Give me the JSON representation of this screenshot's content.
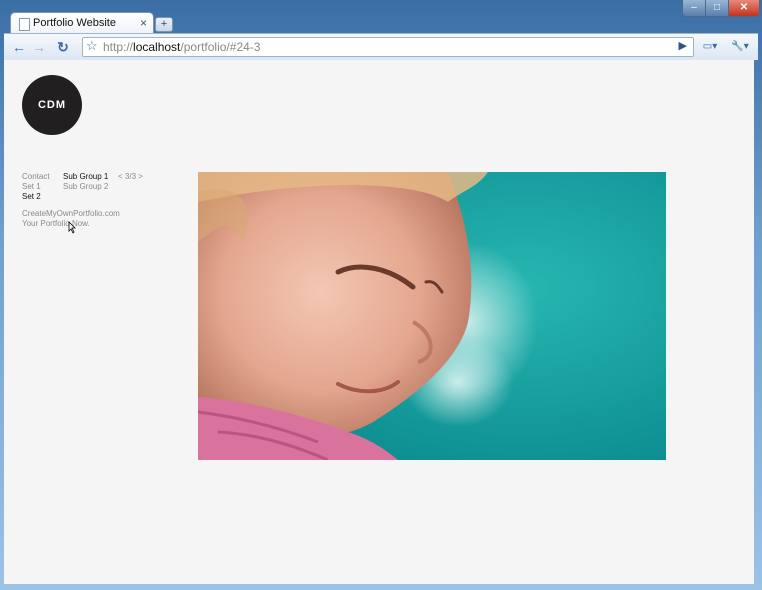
{
  "browser": {
    "tab_title": "Portfolio Website",
    "tab_close": "×",
    "new_tab": "+",
    "url_prefix": "http://",
    "url_host": "localhost",
    "url_path": "/portfolio/#24-3",
    "min": "–",
    "max": "□",
    "close": "✕",
    "back": "←",
    "forward": "→",
    "reload": "↻",
    "bookmark": "☆",
    "go": "▶",
    "page_menu": "▭▾",
    "tools_menu": "🔧▾"
  },
  "site": {
    "logo": "CDM",
    "nav": {
      "contact": "Contact",
      "set1": "Set 1",
      "set2": "Set 2",
      "subgroup1": "Sub Group 1",
      "subgroup2": "Sub Group 2",
      "pager": "< 3/3 >",
      "credit1": "CreateMyOwnPortfolio.com",
      "credit2": "Your Portfolio Now."
    }
  }
}
